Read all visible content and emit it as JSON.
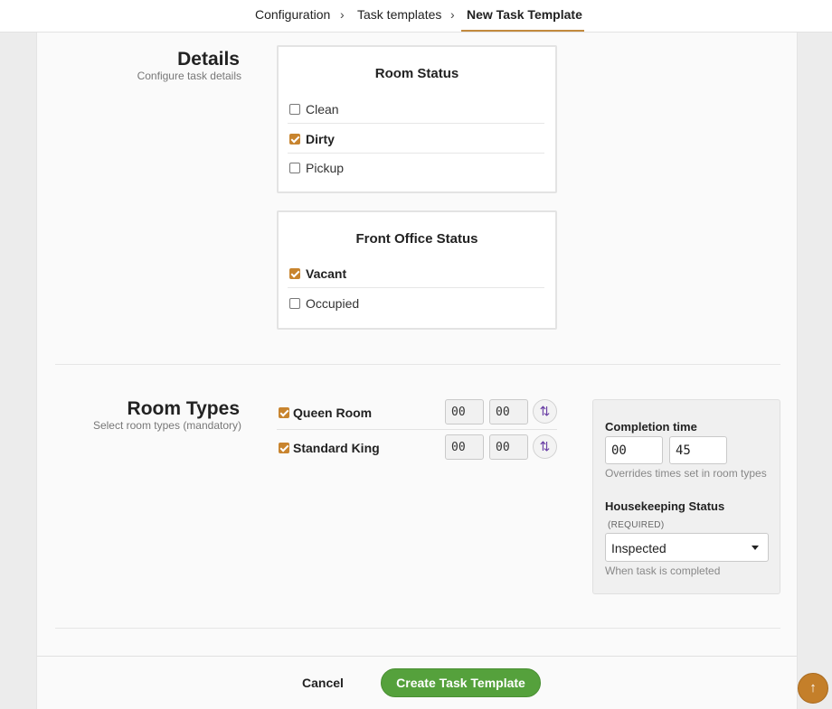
{
  "breadcrumb": {
    "items": [
      "Configuration",
      "Task templates",
      "New Task Template"
    ],
    "separator": "›"
  },
  "details": {
    "title": "Details",
    "subtitle": "Configure task details",
    "room_status": {
      "title": "Room Status",
      "options": [
        {
          "label": "Clean",
          "checked": false
        },
        {
          "label": "Dirty",
          "checked": true
        },
        {
          "label": "Pickup",
          "checked": false
        }
      ]
    },
    "front_office_status": {
      "title": "Front Office Status",
      "options": [
        {
          "label": "Vacant",
          "checked": true
        },
        {
          "label": "Occupied",
          "checked": false
        }
      ]
    }
  },
  "room_types": {
    "title": "Room Types",
    "subtitle": "Select room types (mandatory)",
    "rows": [
      {
        "label": "Queen Room",
        "checked": true,
        "hours": "00",
        "minutes": "00",
        "sort_icon": "sort-arrows-icon"
      },
      {
        "label": "Standard King",
        "checked": true,
        "hours": "00",
        "minutes": "00",
        "sort_icon": "sort-arrows-icon"
      }
    ]
  },
  "completion": {
    "title": "Completion time",
    "hours": "00",
    "minutes": "45",
    "help": "Overrides times set in room types"
  },
  "housekeeping": {
    "title": "Housekeeping Status",
    "required": "(REQUIRED)",
    "selected": "Inspected",
    "help": "When task is completed"
  },
  "footer": {
    "cancel_label": "Cancel",
    "create_label": "Create Task Template"
  },
  "scroll_top": {
    "icon": "arrow-up-icon",
    "glyph": "↑"
  },
  "colors": {
    "accent": "#c8842e",
    "primary_button": "#55a13c",
    "sort_icon": "#6a3fa5"
  }
}
